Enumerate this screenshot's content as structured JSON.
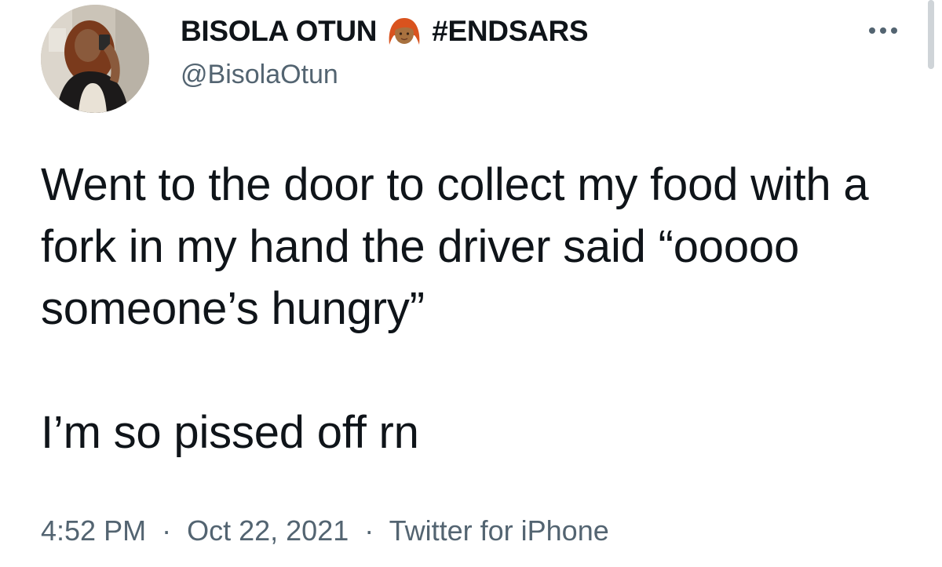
{
  "author": {
    "display_name": "BISOLA OTUN",
    "emoji": "woman-red-hair-emoji",
    "hashtag": "#ENDSARS",
    "handle": "@BisolaOtun",
    "avatar": "profile-photo"
  },
  "tweet": {
    "text_line_1": "Went to the door to collect my food with a fork in my hand the driver said “ooooo someone’s hungry”",
    "text_line_2": "I’m so pissed off rn"
  },
  "meta": {
    "time": "4:52 PM",
    "separator": "·",
    "date": "Oct 22, 2021",
    "source": "Twitter for iPhone"
  },
  "icons": {
    "more": "more-horizontal-icon"
  },
  "colors": {
    "text": "#0f1419",
    "secondary": "#536471",
    "background": "#ffffff"
  }
}
